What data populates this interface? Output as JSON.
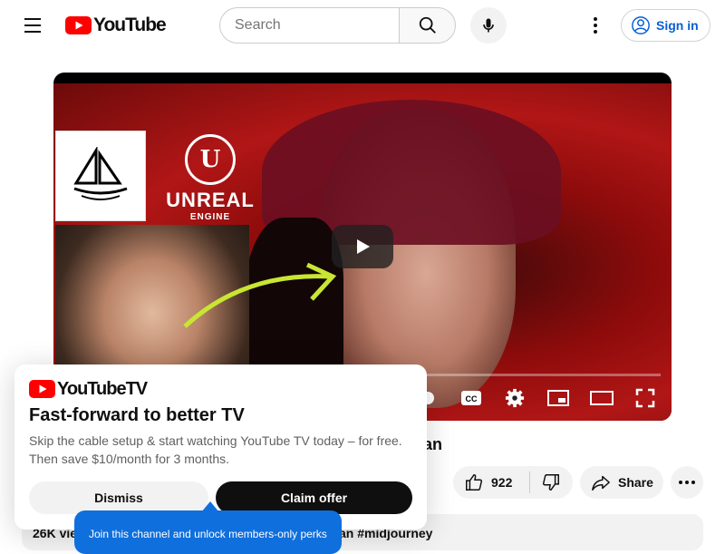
{
  "header": {
    "logo_text": "YouTube",
    "search_placeholder": "Search",
    "signin_label": "Sign in"
  },
  "video": {
    "thumbnail_text_line1": "UNREAL",
    "thumbnail_text_line2": "ENGINE",
    "unreal_mark": "U"
  },
  "below_video": {
    "title_fragment": "an",
    "like_count": "922",
    "share_label": "Share",
    "views_fragment": "26K vie",
    "tags_fragment": "an #midjourney"
  },
  "promo": {
    "logo_text": "YouTubeTV",
    "title": "Fast-forward to better TV",
    "body": "Skip the cable setup & start watching YouTube TV today – for free. Then save $10/month for 3 months.",
    "dismiss_label": "Dismiss",
    "claim_label": "Claim offer"
  },
  "tooltip": {
    "text": "Join this channel and unlock members-only perks"
  },
  "colors": {
    "brand_red": "#ff0000",
    "link_blue": "#065fd4",
    "tooltip_blue": "#0f6fdd"
  },
  "icons": [
    "menu-icon",
    "youtube-logo-icon",
    "search-icon",
    "mic-icon",
    "more-vert-icon",
    "account-icon",
    "play-icon",
    "autoplay-icon",
    "captions-icon",
    "settings-icon",
    "miniplayer-icon",
    "theater-icon",
    "fullscreen-icon",
    "thumb-up-icon",
    "thumb-down-icon",
    "share-icon",
    "more-horiz-icon"
  ]
}
